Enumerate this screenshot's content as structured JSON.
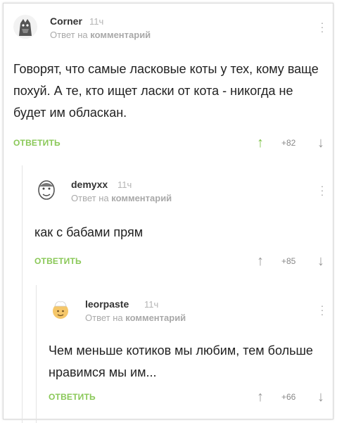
{
  "comments": [
    {
      "username": "Corner",
      "time": "11ч",
      "reply_prefix": "Ответ на",
      "reply_target": "комментарий",
      "text": "Говорят, что самые ласковые коты у тех, кому ваще похуй. А те, кто ищет ласки от кота - никогда не будет им обласкан.",
      "reply_label": "ОТВЕТИТЬ",
      "rating": "+82",
      "avatar_icon": "cat-avatar-icon"
    },
    {
      "username": "demyxx",
      "time": "11ч",
      "reply_prefix": "Ответ на",
      "reply_target": "комментарий",
      "text": "как с бабами прям",
      "reply_label": "ОТВЕТИТЬ",
      "rating": "+85",
      "avatar_icon": "face-avatar-icon"
    },
    {
      "username": "leorpaste",
      "time": "11ч",
      "reply_prefix": "Ответ на",
      "reply_target": "комментарий",
      "text": "Чем меньше котиков мы любим, тем больше нравимся мы им...",
      "reply_label": "ОТВЕТИТЬ",
      "rating": "+66",
      "avatar_icon": "chef-avatar-icon"
    }
  ],
  "colors": {
    "reply_green": "#8ac858",
    "upvote_active": "#7cc246",
    "muted": "#a9a9a9"
  }
}
